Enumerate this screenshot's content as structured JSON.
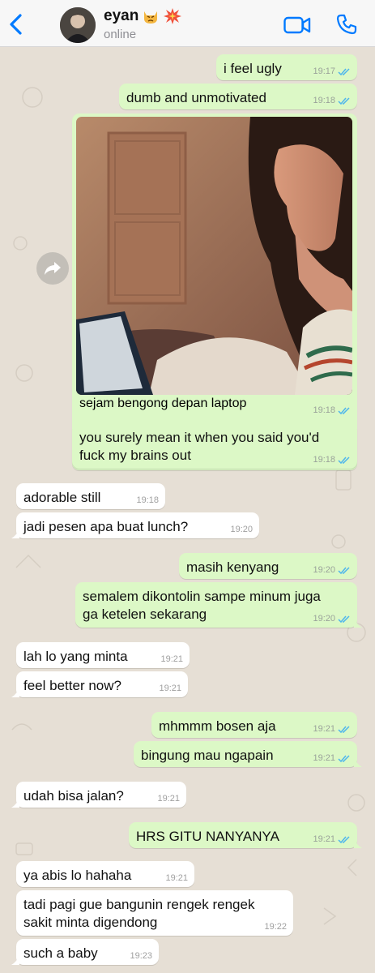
{
  "header": {
    "contact_name": "eyan",
    "status": "online",
    "name_emojis": [
      "angry-cat-emoji",
      "collision-emoji"
    ]
  },
  "messages": [
    {
      "text": "i feel ugly",
      "time": "19:17",
      "dir": "out"
    },
    {
      "text": "dumb and unmotivated",
      "time": "19:18",
      "dir": "out"
    },
    {
      "text": "sejam bengong depan laptop",
      "time": "19:18",
      "dir": "out",
      "has_image": true
    },
    {
      "text1": "you surely mean it when you said you'd",
      "text2": "fuck my brains out",
      "time": "19:18",
      "dir": "out"
    },
    {
      "text": "adorable still",
      "time": "19:18",
      "dir": "in"
    },
    {
      "text": "jadi pesen apa buat lunch?",
      "time": "19:20",
      "dir": "in"
    },
    {
      "text": "masih kenyang",
      "time": "19:20",
      "dir": "out"
    },
    {
      "text1": "semalem dikontolin sampe minum juga",
      "text2": "ga ketelen sekarang",
      "time": "19:20",
      "dir": "out"
    },
    {
      "text": "lah lo yang minta",
      "time": "19:21",
      "dir": "in"
    },
    {
      "text": "feel better now?",
      "time": "19:21",
      "dir": "in"
    },
    {
      "text": "mhmmm bosen aja",
      "time": "19:21",
      "dir": "out"
    },
    {
      "text": "bingung mau ngapain",
      "time": "19:21",
      "dir": "out"
    },
    {
      "text": "udah bisa jalan?",
      "time": "19:21",
      "dir": "in"
    },
    {
      "text": "HRS GITU NANYANYA",
      "time": "19:21",
      "dir": "out"
    },
    {
      "text": "ya abis lo hahaha",
      "time": "19:21",
      "dir": "in"
    },
    {
      "text1": "tadi pagi gue bangunin rengek rengek",
      "text2": "sakit minta digendong",
      "time": "19:22",
      "dir": "in"
    },
    {
      "text": "such a baby",
      "time": "19:23",
      "dir": "in"
    }
  ],
  "colors": {
    "outgoing": "#dcf8c6",
    "incoming": "#ffffff",
    "accent": "#007aff",
    "read_ticks": "#4fb6ec",
    "background": "#e6dfd5"
  }
}
